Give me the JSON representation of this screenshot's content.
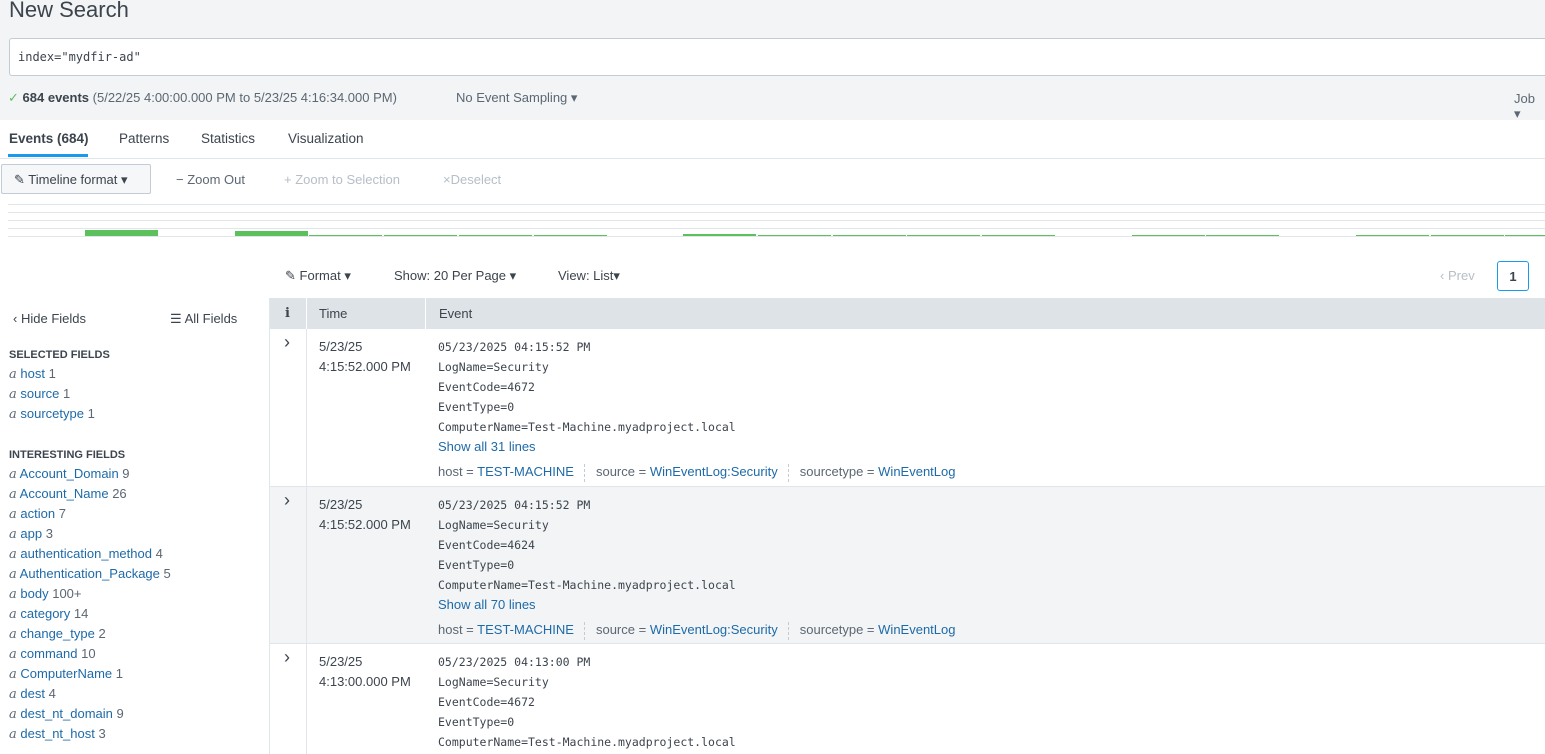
{
  "page": {
    "title": "New Search"
  },
  "search": {
    "query": "index=\"mydfir-ad\""
  },
  "status": {
    "check": "✓",
    "count": "684 events",
    "range": "(5/22/25 4:00:00.000 PM to 5/23/25 4:16:34.000 PM)",
    "sampling": "No Event Sampling",
    "job": "Job"
  },
  "tabs": [
    "Events (684)",
    "Patterns",
    "Statistics",
    "Visualization"
  ],
  "toolbar": {
    "timeline_format": "Timeline format",
    "zoom_out": "Zoom Out",
    "zoom_selection": "Zoom to Selection",
    "deselect": "Deselect"
  },
  "colors": {
    "accent": "#1a9aef",
    "link": "#1e6aa8",
    "timeline_bar": "#5cc05c"
  },
  "results_controls": {
    "format": "Format",
    "per_page": "Show: 20 Per Page",
    "view": "View: List",
    "prev": "Prev",
    "page": "1"
  },
  "sidebar": {
    "hide_fields": "Hide Fields",
    "all_fields": "All Fields",
    "selected_heading": "SELECTED FIELDS",
    "interesting_heading": "INTERESTING FIELDS",
    "type_glyph": "a",
    "selected": [
      {
        "name": "host",
        "count": "1"
      },
      {
        "name": "source",
        "count": "1"
      },
      {
        "name": "sourcetype",
        "count": "1"
      }
    ],
    "interesting": [
      {
        "name": "Account_Domain",
        "count": "9"
      },
      {
        "name": "Account_Name",
        "count": "26"
      },
      {
        "name": "action",
        "count": "7"
      },
      {
        "name": "app",
        "count": "3"
      },
      {
        "name": "authentication_method",
        "count": "4"
      },
      {
        "name": "Authentication_Package",
        "count": "5"
      },
      {
        "name": "body",
        "count": "100+"
      },
      {
        "name": "category",
        "count": "14"
      },
      {
        "name": "change_type",
        "count": "2"
      },
      {
        "name": "command",
        "count": "10"
      },
      {
        "name": "ComputerName",
        "count": "1"
      },
      {
        "name": "dest",
        "count": "4"
      },
      {
        "name": "dest_nt_domain",
        "count": "9"
      },
      {
        "name": "dest_nt_host",
        "count": "3"
      }
    ]
  },
  "table": {
    "headers": {
      "info": "i",
      "time": "Time",
      "event": "Event"
    },
    "events": [
      {
        "date": "5/23/25",
        "time": "4:15:52.000 PM",
        "lines": [
          "05/23/2025 04:15:52 PM",
          "LogName=Security",
          "EventCode=4672",
          "EventType=0",
          "ComputerName=Test-Machine.myadproject.local"
        ],
        "show_all": "Show all 31 lines",
        "host": "TEST-MACHINE",
        "source": "WinEventLog:Security",
        "sourcetype": "WinEventLog"
      },
      {
        "date": "5/23/25",
        "time": "4:15:52.000 PM",
        "lines": [
          "05/23/2025 04:15:52 PM",
          "LogName=Security",
          "EventCode=4624",
          "EventType=0",
          "ComputerName=Test-Machine.myadproject.local"
        ],
        "show_all": "Show all 70 lines",
        "host": "TEST-MACHINE",
        "source": "WinEventLog:Security",
        "sourcetype": "WinEventLog"
      },
      {
        "date": "5/23/25",
        "time": "4:13:00.000 PM",
        "lines": [
          "05/23/2025 04:13:00 PM",
          "LogName=Security",
          "EventCode=4672",
          "EventType=0",
          "ComputerName=Test-Machine.myadproject.local"
        ]
      }
    ],
    "meta_labels": {
      "host": "host =",
      "source": "source =",
      "sourcetype": "sourcetype ="
    }
  },
  "timeline": {
    "bars": [
      {
        "level": 1.0
      },
      {
        "level": 0
      },
      {
        "level": 0.8
      },
      {
        "level": 0.15
      },
      {
        "level": 0.15
      },
      {
        "level": 0.15
      },
      {
        "level": 0.15
      },
      {
        "level": 0
      },
      {
        "level": 0.35
      },
      {
        "level": 0.15
      },
      {
        "level": 0.15
      },
      {
        "level": 0.15
      },
      {
        "level": 0.15
      },
      {
        "level": 0
      },
      {
        "level": 0.15
      },
      {
        "level": 0.15
      },
      {
        "level": 0
      },
      {
        "level": 0.15
      },
      {
        "level": 0.15
      },
      {
        "level": 0.15
      }
    ]
  }
}
